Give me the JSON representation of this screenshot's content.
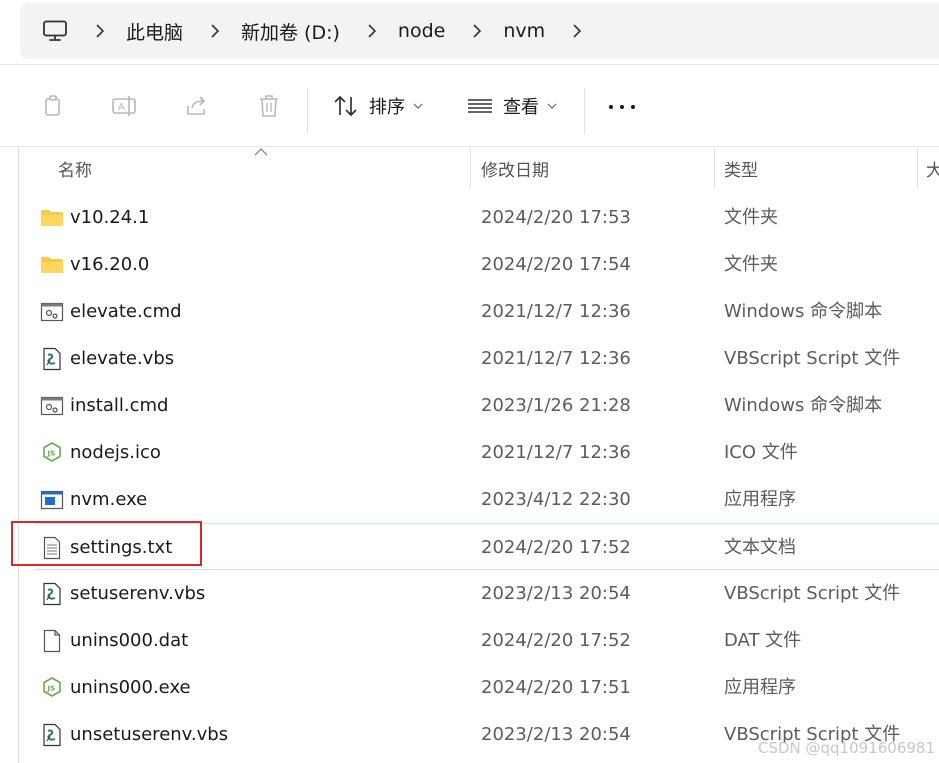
{
  "address_bar": {
    "items": [
      {
        "label": "此电脑"
      },
      {
        "label": "新加卷 (D:)"
      },
      {
        "label": "node"
      },
      {
        "label": "nvm"
      }
    ]
  },
  "toolbar": {
    "sort_label": "排序",
    "view_label": "查看",
    "icons": [
      "copy-icon",
      "rename-icon",
      "share-icon",
      "delete-icon",
      "sort-icon",
      "view-icon",
      "more-icon"
    ]
  },
  "columns": {
    "name": "名称",
    "date": "修改日期",
    "type": "类型",
    "size": "大"
  },
  "files": [
    {
      "name": "v10.24.1",
      "date": "2024/2/20 17:53",
      "type": "文件夹",
      "icon": "folder-icon"
    },
    {
      "name": "v16.20.0",
      "date": "2024/2/20 17:54",
      "type": "文件夹",
      "icon": "folder-icon"
    },
    {
      "name": "elevate.cmd",
      "date": "2021/12/7 12:36",
      "type": "Windows 命令脚本",
      "icon": "cmd-file-icon"
    },
    {
      "name": "elevate.vbs",
      "date": "2021/12/7 12:36",
      "type": "VBScript Script 文件",
      "icon": "vbs-file-icon"
    },
    {
      "name": "install.cmd",
      "date": "2023/1/26 21:28",
      "type": "Windows 命令脚本",
      "icon": "cmd-file-icon"
    },
    {
      "name": "nodejs.ico",
      "date": "2021/12/7 12:36",
      "type": "ICO 文件",
      "icon": "nodejs-icon"
    },
    {
      "name": "nvm.exe",
      "date": "2023/4/12 22:30",
      "type": "应用程序",
      "icon": "exe-file-icon"
    },
    {
      "name": "settings.txt",
      "date": "2024/2/20 17:52",
      "type": "文本文档",
      "icon": "text-file-icon",
      "selected": true
    },
    {
      "name": "setuserenv.vbs",
      "date": "2023/2/13 20:54",
      "type": "VBScript Script 文件",
      "icon": "vbs-file-icon"
    },
    {
      "name": "unins000.dat",
      "date": "2024/2/20 17:52",
      "type": "DAT 文件",
      "icon": "blank-file-icon"
    },
    {
      "name": "unins000.exe",
      "date": "2024/2/20 17:51",
      "type": "应用程序",
      "icon": "nodejs-icon"
    },
    {
      "name": "unsetuserenv.vbs",
      "date": "2023/2/13 20:54",
      "type": "VBScript Script 文件",
      "icon": "vbs-file-icon"
    }
  ],
  "watermark": "CSDN @qq1091606981",
  "colors": {
    "highlight": "#d9272e",
    "folder": "#f7c94a",
    "nodejs_green": "#6aa84f",
    "selection_border": "#c7e0f4"
  }
}
